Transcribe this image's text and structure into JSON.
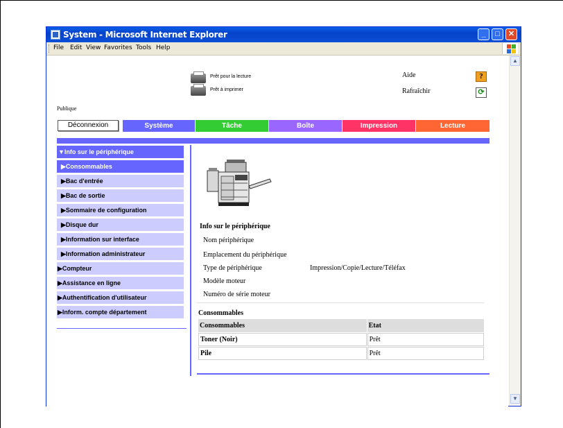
{
  "window": {
    "title": "System - Microsoft Internet Explorer",
    "controls": {
      "minimize": "_",
      "maximize": "□",
      "close": "✕"
    }
  },
  "menubar": {
    "items": [
      "File",
      "Edit",
      "View",
      "Favorites",
      "Tools",
      "Help"
    ]
  },
  "header": {
    "status_read": "Prêt pour la lecture",
    "status_print": "Prêt à imprimer",
    "help_label": "Aide",
    "help_icon_glyph": "?",
    "refresh_label": "Rafraîchir",
    "refresh_icon_glyph": "⟳",
    "user_mode": "Publique"
  },
  "nav": {
    "logout": "Déconnexion",
    "tabs": [
      {
        "label": "Système",
        "color": "#6666ff"
      },
      {
        "label": "Tâche",
        "color": "#33cc33"
      },
      {
        "label": "Boîte",
        "color": "#9966ff"
      },
      {
        "label": "Impression",
        "color": "#ff3366"
      },
      {
        "label": "Lecture",
        "color": "#ff6633"
      }
    ]
  },
  "sidebar": {
    "items": [
      {
        "label": "▼Info sur le périphérique",
        "level": 0,
        "state": "header"
      },
      {
        "label": "▶Consommables",
        "level": 1,
        "state": "active"
      },
      {
        "label": "▶Bac d'entrée",
        "level": 1,
        "state": "normal"
      },
      {
        "label": "▶Bac de sortie",
        "level": 1,
        "state": "normal"
      },
      {
        "label": "▶Sommaire de configuration",
        "level": 1,
        "state": "normal"
      },
      {
        "label": "▶Disque dur",
        "level": 1,
        "state": "normal"
      },
      {
        "label": "▶Information sur interface",
        "level": 1,
        "state": "normal"
      },
      {
        "label": "▶Information administrateur",
        "level": 1,
        "state": "normal"
      },
      {
        "label": "▶Compteur",
        "level": 0,
        "state": "normal"
      },
      {
        "label": "▶Assistance en ligne",
        "level": 0,
        "state": "normal"
      },
      {
        "label": "▶Authentification d'utilisateur",
        "level": 0,
        "state": "normal"
      },
      {
        "label": "▶Inform. compte département",
        "level": 0,
        "state": "normal"
      }
    ]
  },
  "device_info": {
    "title": "Info sur le périphérique",
    "rows": [
      {
        "label": "Nom périphérique",
        "value": ""
      },
      {
        "label": "Emplacement du périphérique",
        "value": ""
      },
      {
        "label": "Type de périphérique",
        "value": "Impression/Copie/Lecture/Téléfax"
      },
      {
        "label": "Modèle moteur",
        "value": ""
      },
      {
        "label": "Numéro de série moteur",
        "value": ""
      }
    ]
  },
  "consumables": {
    "title": "Consommables",
    "columns": [
      "Consommables",
      "Etat"
    ],
    "rows": [
      [
        "Toner (Noir)",
        "Prêt"
      ],
      [
        "Pile",
        "Prêt"
      ]
    ]
  }
}
